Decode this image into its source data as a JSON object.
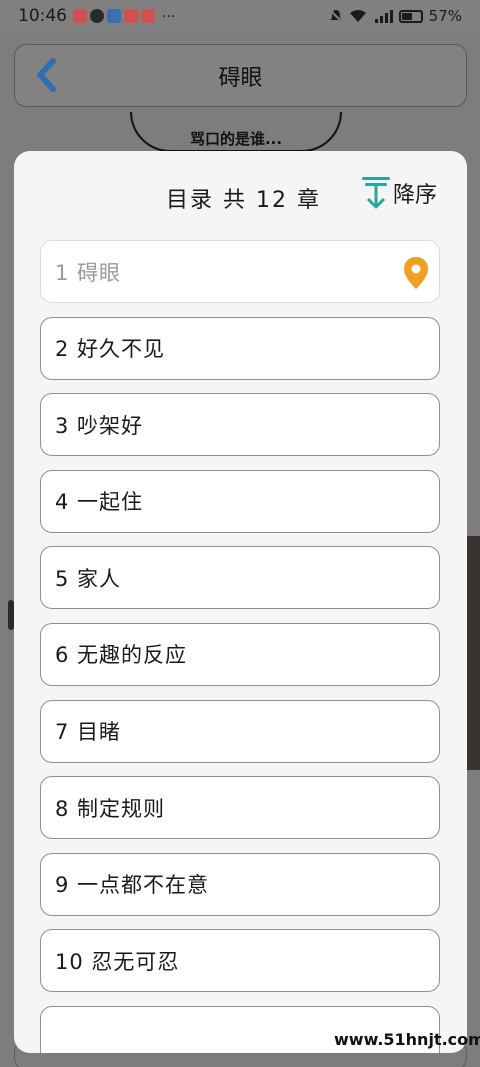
{
  "status_bar": {
    "time": "10:46",
    "more": "···",
    "battery": "57%"
  },
  "header": {
    "title": "碍眼"
  },
  "background": {
    "snippet": "骂口的是谁..."
  },
  "toc": {
    "title": "目录 共 12 章",
    "sort_label": "降序"
  },
  "chapters": [
    {
      "label": "1 碍眼",
      "current": true
    },
    {
      "label": "2 好久不见"
    },
    {
      "label": "3 吵架好"
    },
    {
      "label": "4 一起住"
    },
    {
      "label": "5 家人"
    },
    {
      "label": "6 无趣的反应"
    },
    {
      "label": "7 目睹"
    },
    {
      "label": "8 制定规则"
    },
    {
      "label": "9 一点都不在意"
    },
    {
      "label": "10 忍无可忍"
    },
    {
      "label": ""
    }
  ],
  "watermark": "www.51hnjt.com",
  "colors": {
    "accent_teal": "#2aa5a0",
    "location_orange": "#f0a020",
    "back_arrow_blue": "#2f6fb0"
  }
}
